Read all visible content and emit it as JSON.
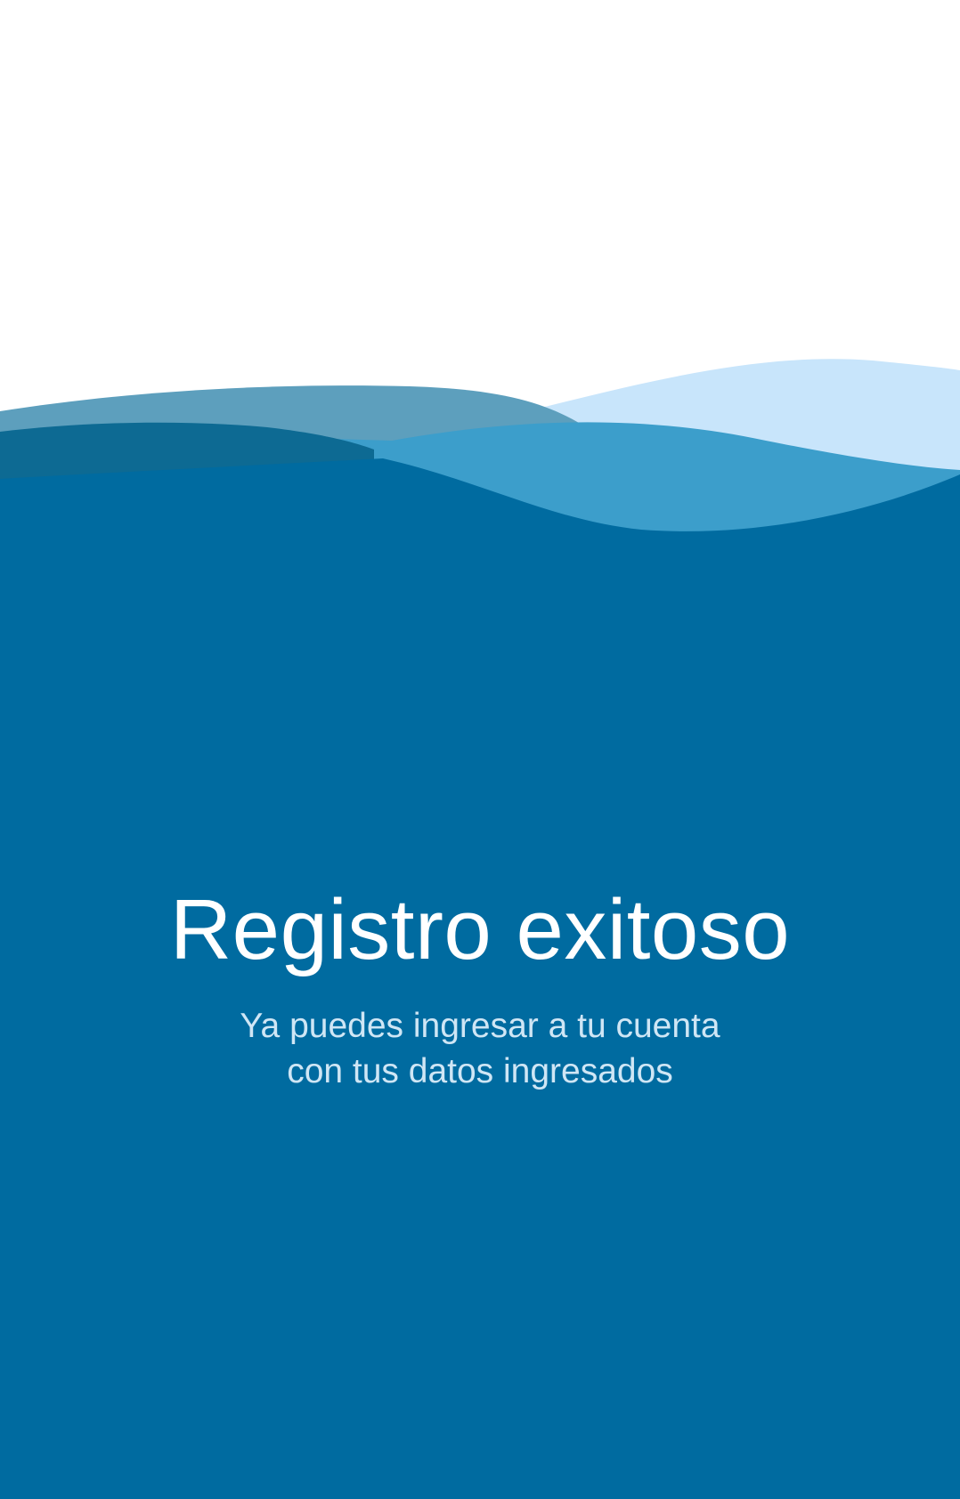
{
  "success_screen": {
    "title": "Registro exitoso",
    "message_line_1": "Ya puedes ingresar a tu cuenta",
    "message_line_2": "con tus datos ingresados"
  },
  "colors": {
    "background_top": "#ffffff",
    "deep_blue": "#006ba0",
    "medium_blue": "#3c9ecb",
    "steel_blue": "#5d9fbd",
    "dark_teal_blue": "#0d6a93",
    "light_blue": "#c8e5fb",
    "title_text": "#ffffff",
    "subtitle_text": "#cfe6f5"
  }
}
